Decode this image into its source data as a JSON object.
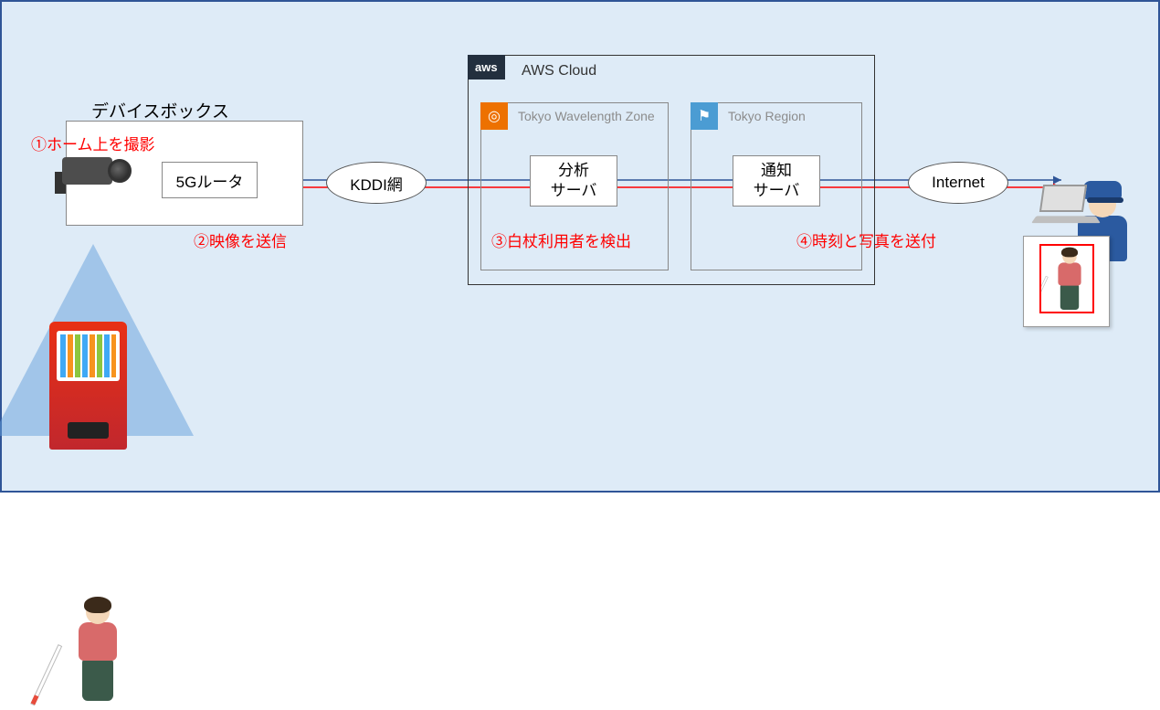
{
  "device_box": {
    "title": "デバイスボックス",
    "router_label": "5Gルータ"
  },
  "steps": {
    "s1": "①ホーム上を撮影",
    "s2": "②映像を送信",
    "s3": "③白杖利用者を検出",
    "s4": "④時刻と写真を送付"
  },
  "network": {
    "kddi": "KDDI網",
    "internet": "Internet"
  },
  "aws": {
    "cloud_label": "AWS Cloud",
    "wavelength_label": "Tokyo Wavelength Zone",
    "region_label": "Tokyo Region",
    "analysis_server_l1": "分析",
    "analysis_server_l2": "サーバ",
    "notify_server_l1": "通知",
    "notify_server_l2": "サーバ"
  },
  "icons": {
    "aws_tag": "aws",
    "wavelength_icon": "◎",
    "region_flag": "⚑"
  }
}
